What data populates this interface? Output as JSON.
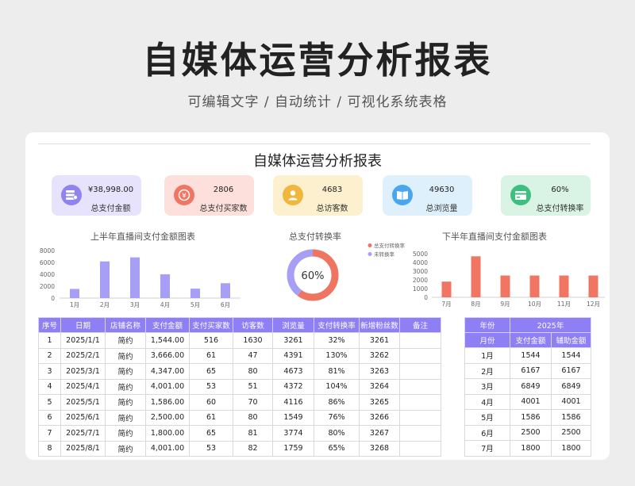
{
  "hero": {
    "title": "自媒体运营分析报表",
    "subtitle": "可编辑文字 / 自动统计 / 可视化系统表格"
  },
  "sheet": {
    "title": "自媒体运营分析报表"
  },
  "kpis": [
    {
      "value": "¥38,998.00",
      "label": "总支付金额",
      "bg": "#e8e3fc",
      "icon_bg": "#8f83ee",
      "icon": "money-stack-icon"
    },
    {
      "value": "2806",
      "label": "总支付买家数",
      "bg": "#fde0dc",
      "icon_bg": "#f07563",
      "icon": "buyer-coin-icon"
    },
    {
      "value": "4683",
      "label": "总访客数",
      "bg": "#fdf0cf",
      "icon_bg": "#f0b63d",
      "icon": "visitor-icon"
    },
    {
      "value": "49630",
      "label": "总浏览量",
      "bg": "#dff0fd",
      "icon_bg": "#4aa6ef",
      "icon": "book-icon"
    },
    {
      "value": "60%",
      "label": "总支付转换率",
      "bg": "#d9f3e5",
      "icon_bg": "#3fbf7f",
      "icon": "card-icon"
    }
  ],
  "chart_data": [
    {
      "type": "bar",
      "title": "上半年直播间支付金额图表",
      "categories": [
        "1月",
        "2月",
        "3月",
        "4月",
        "5月",
        "6月"
      ],
      "values": [
        1544,
        6167,
        6849,
        4001,
        1586,
        2500
      ],
      "yticks": [
        "0",
        "2000",
        "4000",
        "6000",
        "8000"
      ],
      "ylim": [
        0,
        8000
      ],
      "color": "#a79ef5",
      "grid": false
    },
    {
      "type": "pie",
      "title": "总支付转换率",
      "center_label": "60%",
      "slices": [
        {
          "name": "总支付转换率",
          "value": 60,
          "color": "#ef7462"
        },
        {
          "name": "未转换率",
          "value": 40,
          "color": "#a79ef5"
        }
      ],
      "legend": "top-right"
    },
    {
      "type": "bar",
      "title": "下半年直播间支付金额图表",
      "categories": [
        "7月",
        "8月",
        "9月",
        "10月",
        "11月",
        "12月"
      ],
      "values": [
        1800,
        4700,
        2500,
        2500,
        2500,
        2500
      ],
      "yticks": [
        "0",
        "1000",
        "2000",
        "3000",
        "4000",
        "5000"
      ],
      "ylim": [
        0,
        5000
      ],
      "color": "#f07563",
      "grid": false
    }
  ],
  "main_table": {
    "headers": [
      "序号",
      "日期",
      "店铺名称",
      "支付金额",
      "支付买家数",
      "访客数",
      "浏览量",
      "支付转换率",
      "新增粉丝数",
      "备注"
    ],
    "rows": [
      [
        "1",
        "2025/1/1",
        "简约",
        "1,544.00",
        "516",
        "1630",
        "3261",
        "32%",
        "3261",
        ""
      ],
      [
        "2",
        "2025/2/1",
        "简约",
        "3,666.00",
        "61",
        "47",
        "4391",
        "130%",
        "3262",
        ""
      ],
      [
        "3",
        "2025/3/1",
        "简约",
        "4,347.00",
        "65",
        "80",
        "4673",
        "81%",
        "3263",
        ""
      ],
      [
        "4",
        "2025/4/1",
        "简约",
        "4,001.00",
        "53",
        "51",
        "4372",
        "104%",
        "3264",
        ""
      ],
      [
        "5",
        "2025/5/1",
        "简约",
        "1,586.00",
        "60",
        "70",
        "4116",
        "86%",
        "3265",
        ""
      ],
      [
        "6",
        "2025/6/1",
        "简约",
        "2,500.00",
        "61",
        "80",
        "1549",
        "76%",
        "3266",
        ""
      ],
      [
        "7",
        "2025/7/1",
        "简约",
        "1,800.00",
        "65",
        "81",
        "3774",
        "80%",
        "3267",
        ""
      ],
      [
        "8",
        "2025/8/1",
        "简约",
        "4,001.00",
        "53",
        "82",
        "1759",
        "65%",
        "3268",
        ""
      ]
    ]
  },
  "side_table": {
    "year_label": "年份",
    "year_value": "2025年",
    "headers": [
      "月份",
      "支付金额",
      "辅助金额"
    ],
    "rows": [
      [
        "1月",
        "1544",
        "1544"
      ],
      [
        "2月",
        "6167",
        "6167"
      ],
      [
        "3月",
        "6849",
        "6849"
      ],
      [
        "4月",
        "4001",
        "4001"
      ],
      [
        "5月",
        "1586",
        "1586"
      ],
      [
        "6月",
        "2500",
        "2500"
      ],
      [
        "7月",
        "1800",
        "1800"
      ]
    ]
  }
}
